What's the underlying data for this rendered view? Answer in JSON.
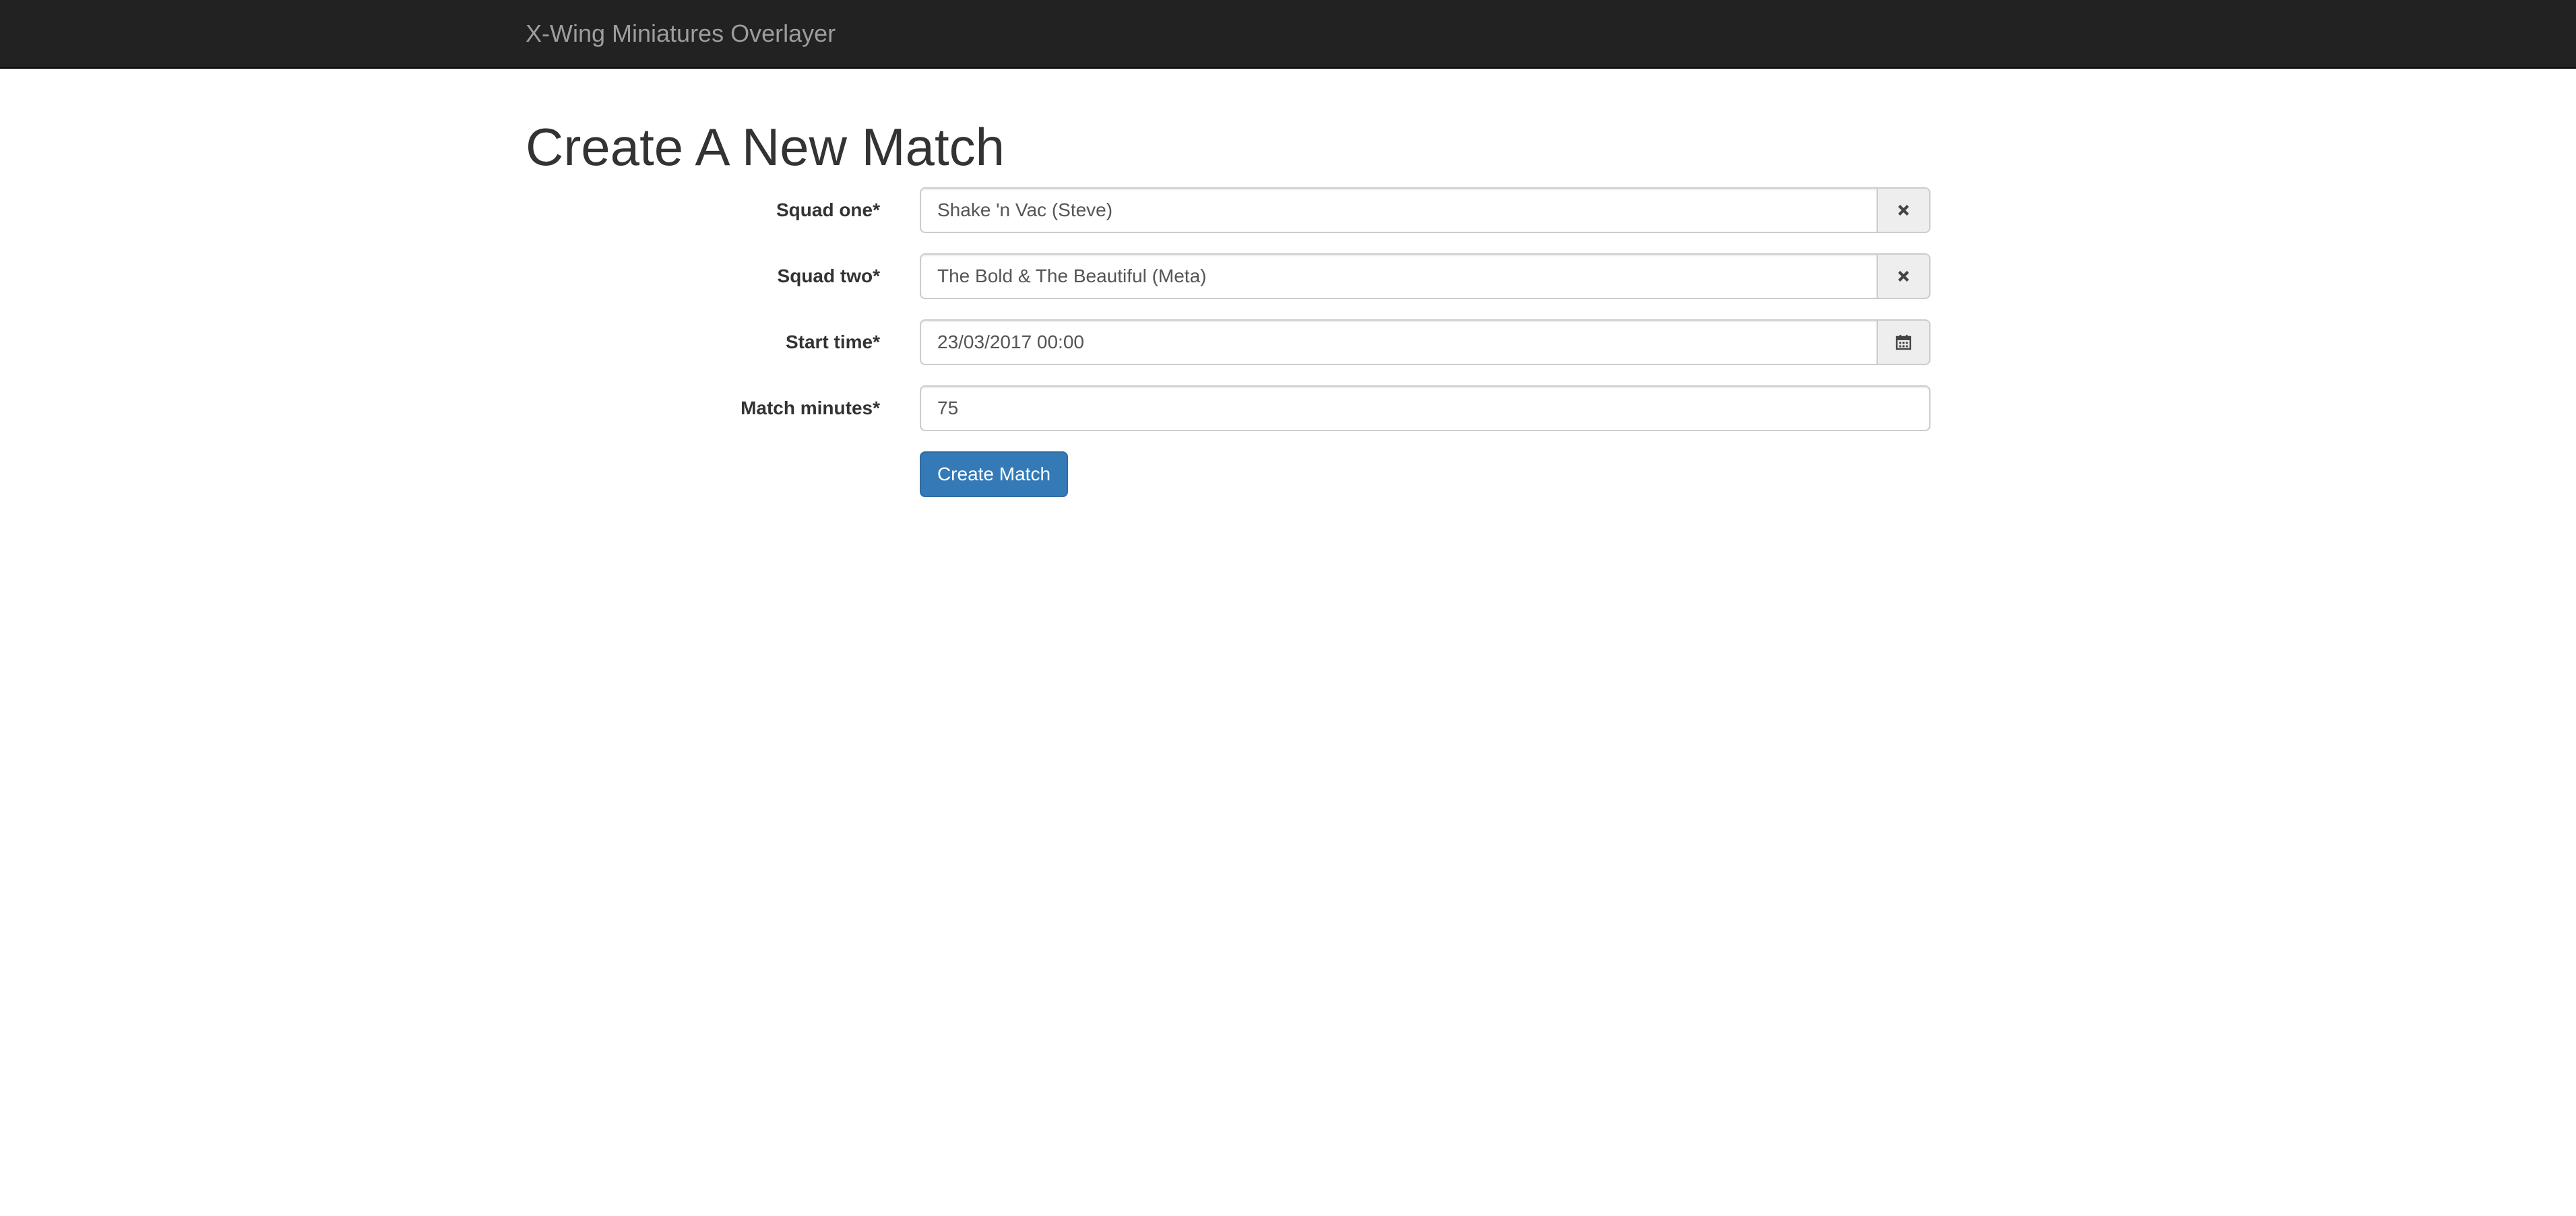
{
  "navbar": {
    "brand": "X-Wing Miniatures Overlayer"
  },
  "page": {
    "title": "Create A New Match"
  },
  "form": {
    "squad_one": {
      "label": "Squad one*",
      "value": "Shake 'n Vac (Steve)",
      "addon_icon": "clear-icon"
    },
    "squad_two": {
      "label": "Squad two*",
      "value": "The Bold & The Beautiful (Meta)",
      "addon_icon": "clear-icon"
    },
    "start_time": {
      "label": "Start time*",
      "value": "23/03/2017 00:00",
      "addon_icon": "calendar-icon"
    },
    "match_minutes": {
      "label": "Match minutes*",
      "value": "75"
    },
    "submit_label": "Create Match"
  },
  "colors": {
    "navbar_bg": "#222222",
    "brand_text": "#9d9d9d",
    "primary": "#337ab7",
    "addon_bg": "#eeeeee"
  }
}
